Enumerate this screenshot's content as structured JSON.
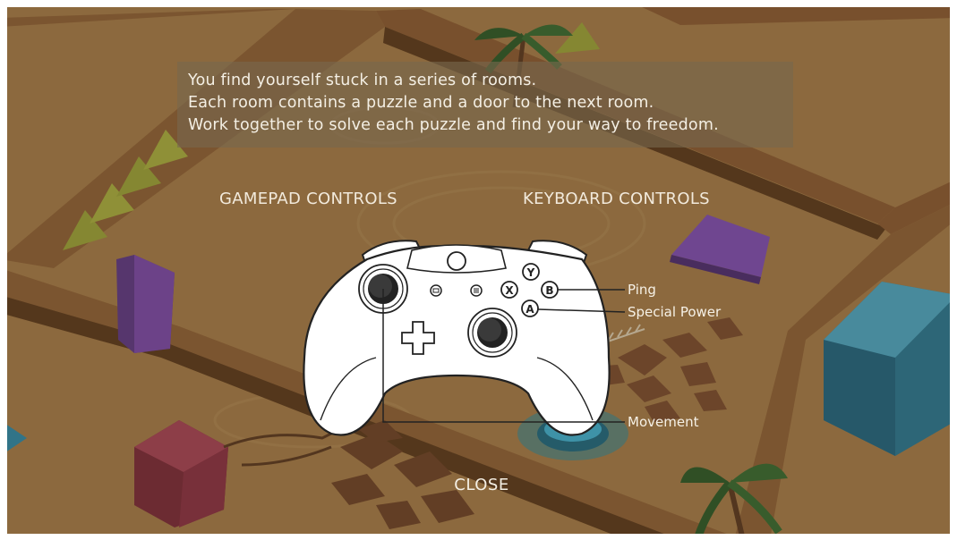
{
  "intro": {
    "lines": [
      "You find yourself stuck in a series of rooms.",
      "Each room contains a puzzle and a door to the next room.",
      "Work together to solve each puzzle and find your way to freedom."
    ]
  },
  "tabs": {
    "gamepad": "GAMEPAD CONTROLS",
    "keyboard": "KEYBOARD CONTROLS"
  },
  "controller": {
    "face_buttons": {
      "y": "Y",
      "x": "X",
      "b": "B",
      "a": "A"
    }
  },
  "callouts": {
    "ping": "Ping",
    "special_power": "Special Power",
    "movement": "Movement"
  },
  "close_label": "CLOSE",
  "colors": {
    "sand": "#c39a5c",
    "wall": "#9a6a3c",
    "purple_block": "#7a4aa8",
    "teal_block": "#2f8aa8",
    "red_block": "#9a3a48",
    "overlay_text": "#f4efe4"
  }
}
